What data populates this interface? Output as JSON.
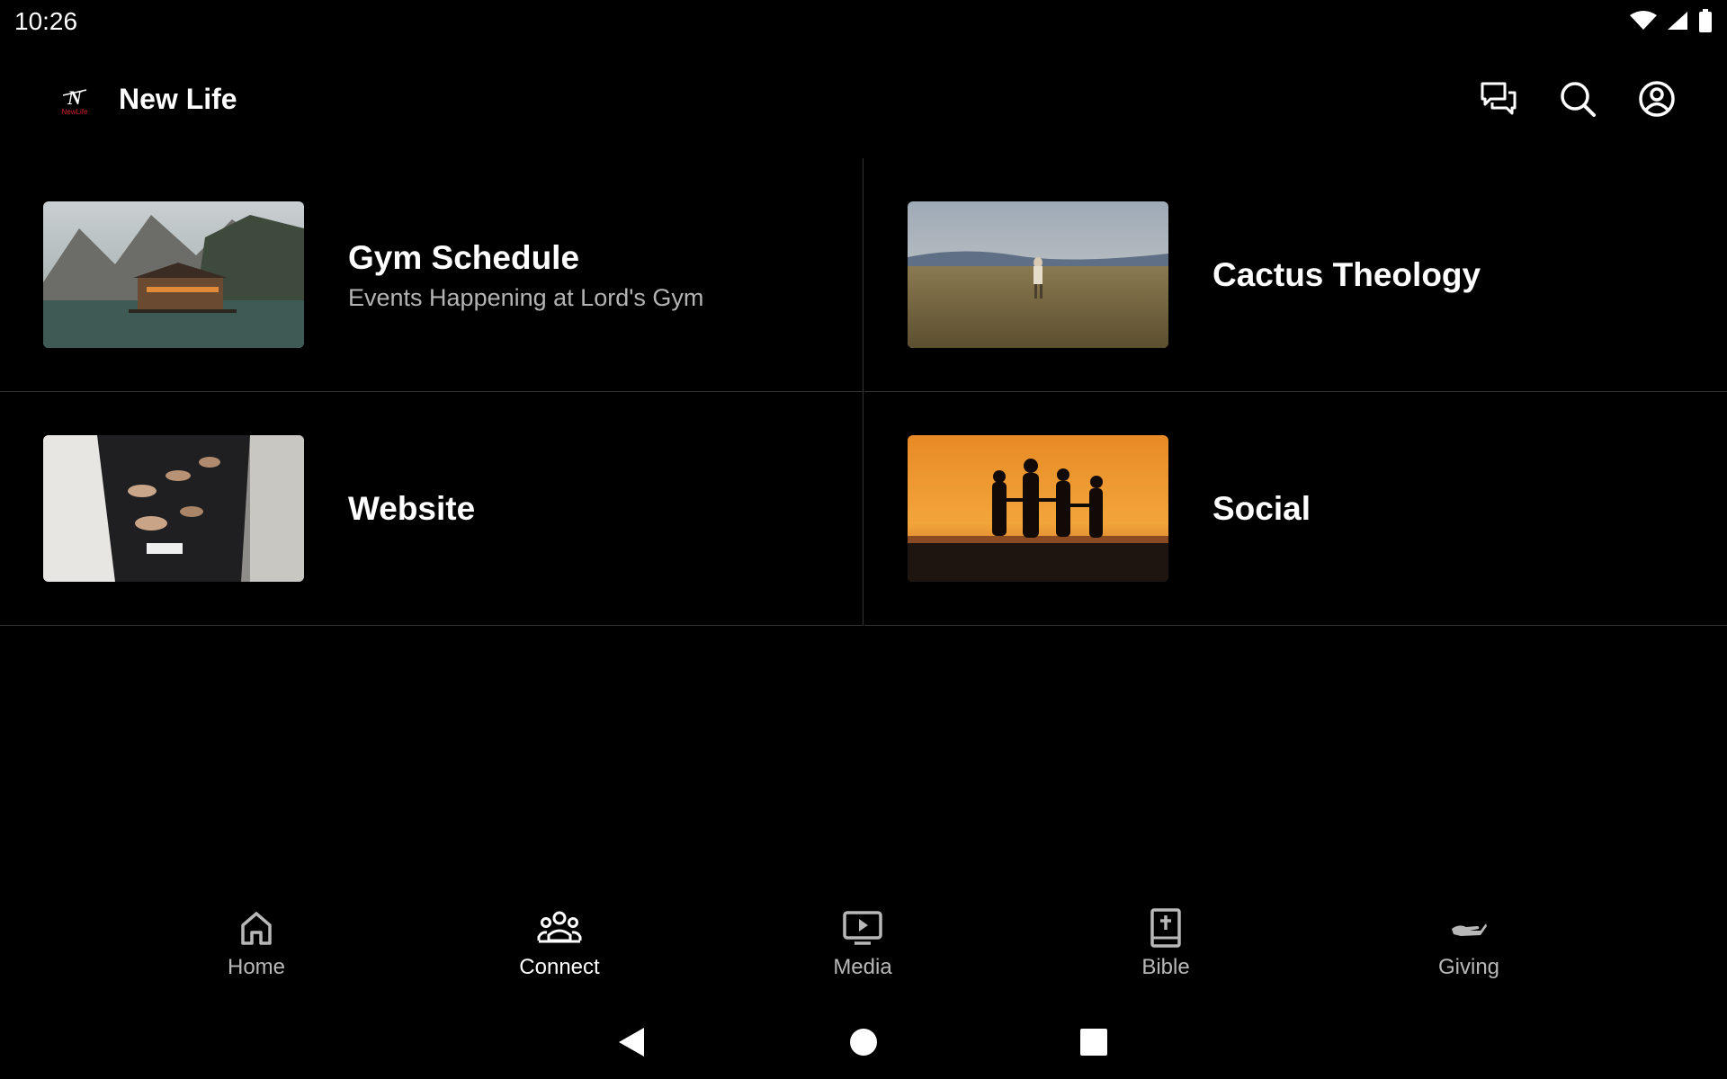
{
  "status_bar": {
    "time": "10:26",
    "icons": [
      "wifi-icon",
      "cell-signal-icon",
      "battery-icon"
    ]
  },
  "app_bar": {
    "logo_icon": "new-life-logo",
    "title": "New Life",
    "actions": [
      "chat-icon",
      "search-icon",
      "account-icon"
    ]
  },
  "items": [
    {
      "title": "Gym Schedule",
      "subtitle": "Events Happening at Lord's Gym",
      "image": "lake-cabin-mountains"
    },
    {
      "title": "Cactus Theology",
      "subtitle": "",
      "image": "person-in-field"
    },
    {
      "title": "Website",
      "subtitle": "",
      "image": "worship-hands"
    },
    {
      "title": "Social",
      "subtitle": "",
      "image": "sunset-silhouettes"
    }
  ],
  "bottom_nav": {
    "items": [
      {
        "label": "Home",
        "icon": "home-icon",
        "active": false
      },
      {
        "label": "Connect",
        "icon": "group-icon",
        "active": true
      },
      {
        "label": "Media",
        "icon": "media-icon",
        "active": false
      },
      {
        "label": "Bible",
        "icon": "bible-icon",
        "active": false
      },
      {
        "label": "Giving",
        "icon": "giving-icon",
        "active": false
      }
    ]
  },
  "colors": {
    "background": "#000000",
    "divider": "#333333",
    "text_primary": "#ffffff",
    "text_secondary": "#b4b4b4",
    "logo_accent": "#d0202a"
  }
}
